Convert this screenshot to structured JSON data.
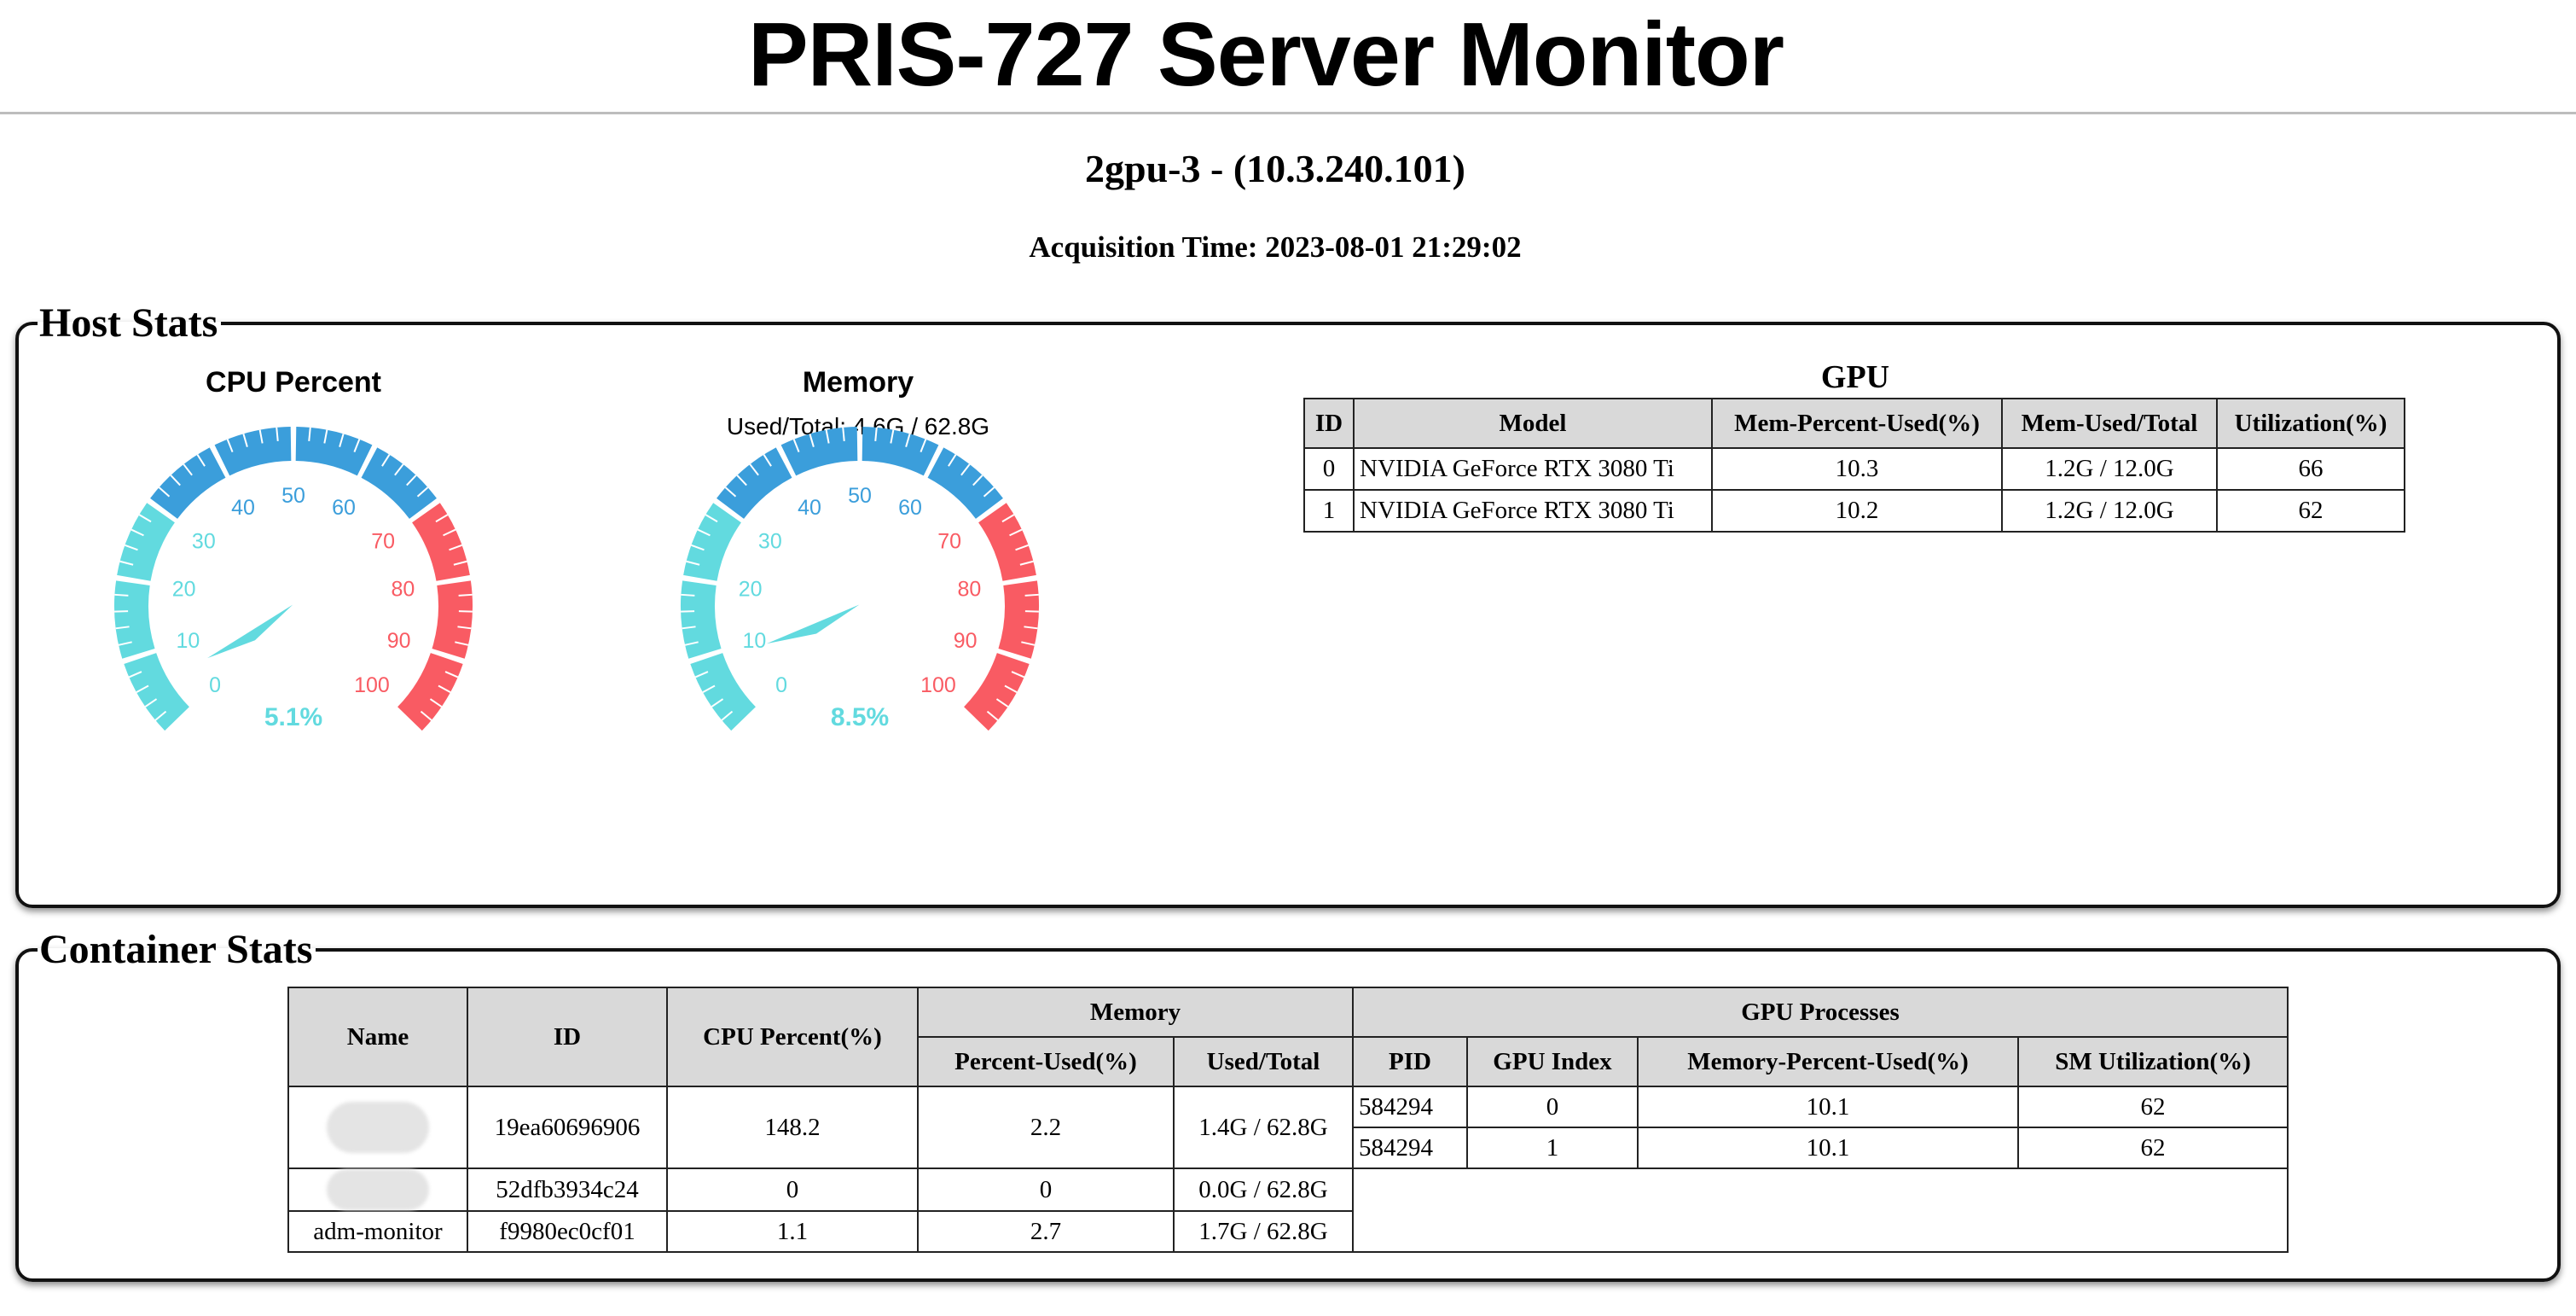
{
  "header": {
    "title": "PRIS-727 Server Monitor",
    "host": "2gpu-3 - (10.3.240.101)",
    "acquisition_time": "Acquisition Time: 2023-08-01 21:29:02"
  },
  "host_stats": {
    "legend": "Host Stats",
    "cpu_gauge": {
      "title": "CPU Percent",
      "value": 5.1,
      "value_label": "5.1%",
      "ticks": [
        "0",
        "10",
        "20",
        "30",
        "40",
        "50",
        "60",
        "70",
        "80",
        "90",
        "100"
      ]
    },
    "memory_gauge": {
      "title": "Memory",
      "subtitle": "Used/Total: 4.6G / 62.8G",
      "value": 8.5,
      "value_label": "8.5%",
      "ticks": [
        "0",
        "10",
        "20",
        "30",
        "40",
        "50",
        "60",
        "70",
        "80",
        "90",
        "100"
      ]
    },
    "gauge_colors": {
      "low": "#62dadf",
      "mid": "#3b9edb",
      "high": "#f95b63"
    },
    "gpu": {
      "title": "GPU",
      "headers": [
        "ID",
        "Model",
        "Mem-Percent-Used(%)",
        "Mem-Used/Total",
        "Utilization(%)"
      ],
      "rows": [
        [
          "0",
          "NVIDIA GeForce RTX 3080 Ti",
          "10.3",
          "1.2G / 12.0G",
          "66"
        ],
        [
          "1",
          "NVIDIA GeForce RTX 3080 Ti",
          "10.2",
          "1.2G / 12.0G",
          "62"
        ]
      ]
    }
  },
  "container_stats": {
    "legend": "Container Stats",
    "headers": {
      "name": "Name",
      "id": "ID",
      "cpu": "CPU Percent(%)",
      "memory": "Memory",
      "mem_percent": "Percent-Used(%)",
      "mem_used": "Used/Total",
      "gpu_processes": "GPU Processes",
      "pid": "PID",
      "gpu_index": "GPU Index",
      "gpu_mem": "Memory-Percent-Used(%)",
      "sm_util": "SM Utilization(%)"
    },
    "containers": [
      {
        "name": "",
        "id": "19ea60696906",
        "cpu": "148.2",
        "mem_percent": "2.2",
        "mem_used": "1.4G / 62.8G",
        "processes": [
          {
            "pid": "584294",
            "gpu_index": "0",
            "mem": "10.1",
            "sm": "62"
          },
          {
            "pid": "584294",
            "gpu_index": "1",
            "mem": "10.1",
            "sm": "62"
          }
        ]
      },
      {
        "name": "",
        "id": "52dfb3934c24",
        "cpu": "0",
        "mem_percent": "0",
        "mem_used": "0.0G / 62.8G",
        "processes": []
      },
      {
        "name": "adm-monitor",
        "id": "f9980ec0cf01",
        "cpu": "1.1",
        "mem_percent": "2.7",
        "mem_used": "1.7G / 62.8G",
        "processes": []
      }
    ]
  }
}
